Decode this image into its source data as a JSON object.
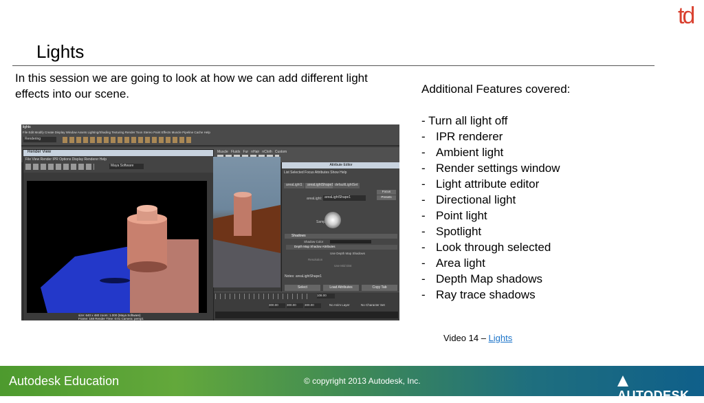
{
  "logo": {
    "text": "td",
    "color": "#d9402f"
  },
  "title": "Lights",
  "intro": "In this session we are going to look at how we can add different light effects into our scene.",
  "screenshot": {
    "app_title": "lights",
    "menu": "File  Edit  Modify  Create  Display  Window  Assets  Lighting/Shading  Texturing  Render  Toon  Stereo  Paint Effects  Muscle  Pipeline Cache  Help",
    "menu_mode": "Rendering",
    "render_view": {
      "title": "Render View",
      "menu": "File  View  Render  IPR  Options  Display  Renderer  Help",
      "renderer": "Maya Software",
      "status_line1": "size: 640 x 480  zoom: 1.000       (Maya Software)",
      "status_line2": "Frame: 168     Render Time: 0:01      Camera: persp1"
    },
    "attribute_editor": {
      "title": "Attribute Editor",
      "menu": "List  Selected  Focus  Attributes  Show  Help",
      "tabs": [
        "areaLight1",
        "areaLightShape1",
        "defaultLightSet"
      ],
      "field_label": "areaLight:",
      "field_value": "areaLightShape1",
      "buttons_side": [
        "Focus",
        "Presets",
        "Show",
        "Hide"
      ],
      "sample_label": "Sample",
      "section_shadows": "Shadows",
      "shadow_color_label": "Shadow Color",
      "section_depth": "Depth Map Shadow Attributes",
      "use_depth": "Use Depth Map Shadows",
      "resolution_label": "Resolution",
      "use_mid_dist": "Use Mid Dist",
      "notes": "Notes: areaLightShape1",
      "bottom_buttons": [
        "Select",
        "Load Attributes",
        "Copy Tab"
      ]
    },
    "timeline": {
      "fields": [
        "300.00",
        "300.00",
        "300.00"
      ],
      "anim_layer": "No Anim Layer",
      "char_set": "No Character Set",
      "frame": "108.00"
    }
  },
  "right": {
    "heading": "Additional Features covered:",
    "first": "- Turn all light off",
    "items": [
      "IPR renderer",
      "Ambient light",
      "Render settings window",
      "Light attribute editor",
      "Directional light",
      "Point light",
      "Spotlight",
      "Look through selected",
      "Area light",
      "Depth Map shadows",
      "Ray trace shadows"
    ]
  },
  "video": {
    "prefix": "Video 14 – ",
    "link": "Lights"
  },
  "footer": {
    "left": "Autodesk Education",
    "center": "© copyright 2013 Autodesk, Inc.",
    "brand": "AUTODESK."
  },
  "colors": {
    "link": "#1a73c9",
    "footer_start": "#4d9a2e",
    "footer_end": "#0f5f8a",
    "accent": "#d9402f"
  }
}
